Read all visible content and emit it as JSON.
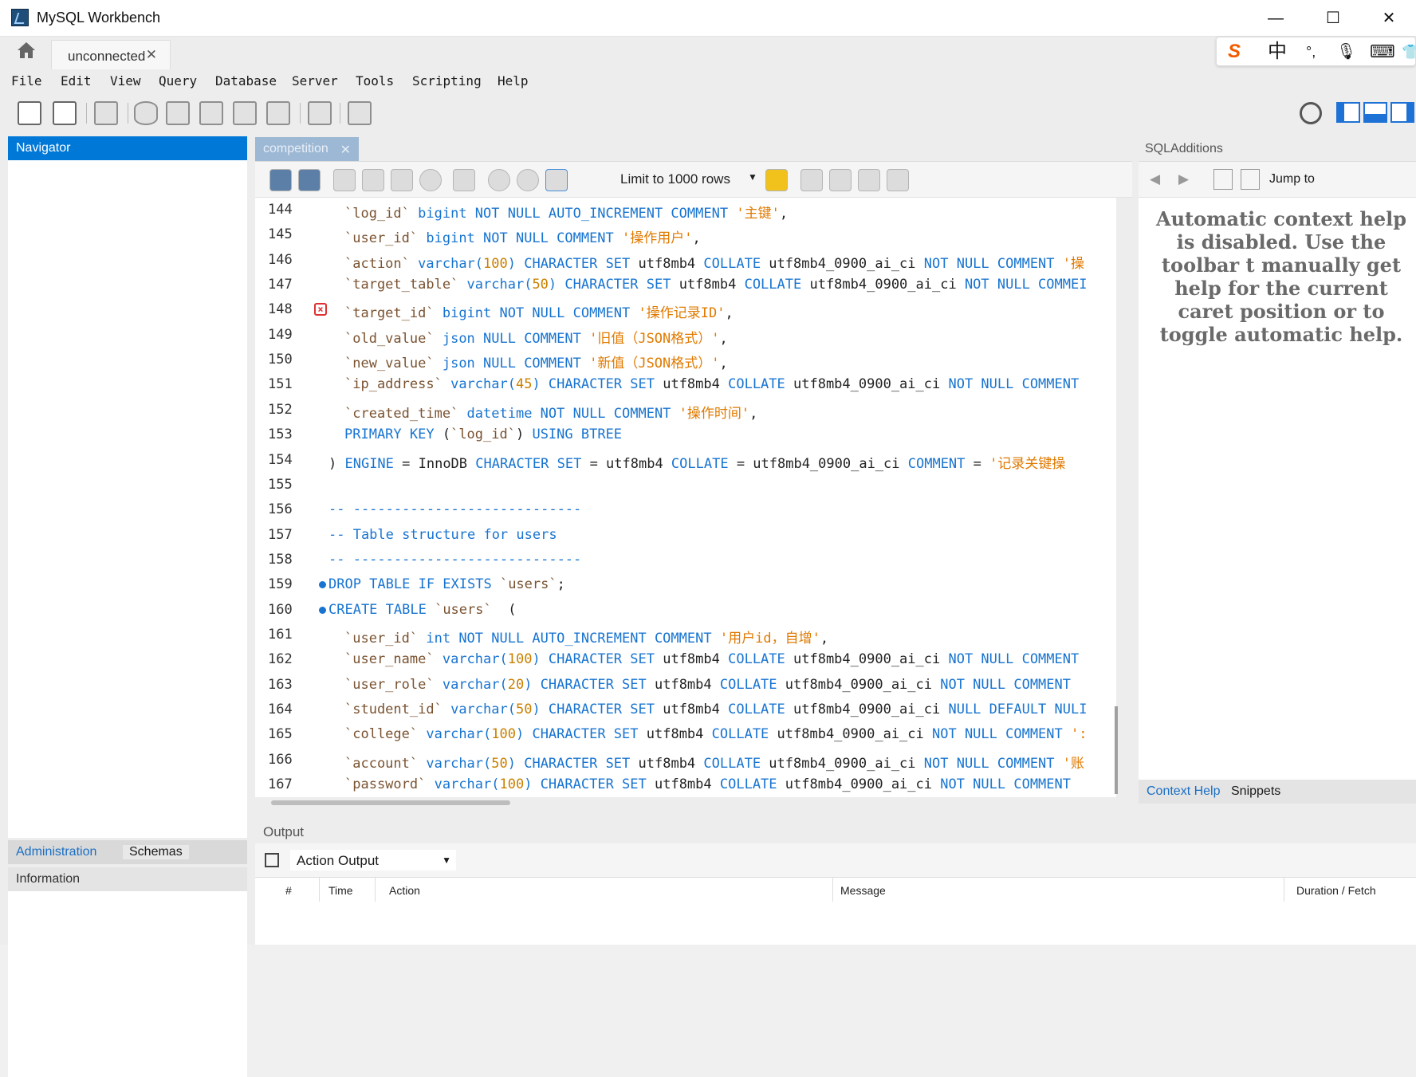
{
  "window": {
    "title": "MySQL Workbench",
    "minimize": "—",
    "maximize": "☐",
    "close": "✕"
  },
  "tabs": {
    "connection_label": "unconnected",
    "close": "✕"
  },
  "ime": {
    "logo": "S",
    "lang": "中",
    "punct": "°,",
    "mic": "🎙",
    "kbd": "⌨",
    "more": "👕"
  },
  "menu": [
    "File",
    "Edit",
    "View",
    "Query",
    "Database",
    "Server",
    "Tools",
    "Scripting",
    "Help"
  ],
  "navigator": {
    "title": "Navigator",
    "tabs": [
      "Administration",
      "Schemas"
    ],
    "info_title": "Information"
  },
  "editor": {
    "tab_label": "competition",
    "limit_label": "Limit to 1000 rows",
    "lines": [
      {
        "n": "144",
        "marker": "",
        "tokens": [
          [
            "id",
            "`log_id`"
          ],
          [
            "plain",
            " "
          ],
          [
            "kw",
            "bigint NOT NULL AUTO_INCREMENT COMMENT"
          ],
          [
            "plain",
            " "
          ],
          [
            "str",
            "'主键'"
          ],
          [
            "plain",
            ","
          ]
        ]
      },
      {
        "n": "145",
        "marker": "",
        "tokens": [
          [
            "id",
            "`user_id`"
          ],
          [
            "plain",
            " "
          ],
          [
            "kw",
            "bigint NOT NULL COMMENT"
          ],
          [
            "plain",
            " "
          ],
          [
            "str",
            "'操作用户'"
          ],
          [
            "plain",
            ","
          ]
        ]
      },
      {
        "n": "146",
        "marker": "",
        "tokens": [
          [
            "id",
            "`action`"
          ],
          [
            "plain",
            " "
          ],
          [
            "kw",
            "varchar("
          ],
          [
            "num",
            "100"
          ],
          [
            "kw",
            ") CHARACTER SET"
          ],
          [
            "plain",
            " utf8mb4 "
          ],
          [
            "kw",
            "COLLATE"
          ],
          [
            "plain",
            " utf8mb4_0900_ai_ci "
          ],
          [
            "kw",
            "NOT NULL COMMENT"
          ],
          [
            "plain",
            " "
          ],
          [
            "str",
            "'操"
          ]
        ]
      },
      {
        "n": "147",
        "marker": "",
        "tokens": [
          [
            "id",
            "`target_table`"
          ],
          [
            "plain",
            " "
          ],
          [
            "kw",
            "varchar("
          ],
          [
            "num",
            "50"
          ],
          [
            "kw",
            ") CHARACTER SET"
          ],
          [
            "plain",
            " utf8mb4 "
          ],
          [
            "kw",
            "COLLATE"
          ],
          [
            "plain",
            " utf8mb4_0900_ai_ci "
          ],
          [
            "kw",
            "NOT NULL COMMEI"
          ]
        ]
      },
      {
        "n": "148",
        "marker": "err",
        "tokens": [
          [
            "id",
            "`target_id`"
          ],
          [
            "plain",
            " "
          ],
          [
            "kw",
            "bigint NOT NULL COMMENT"
          ],
          [
            "plain",
            " "
          ],
          [
            "str",
            "'操作记录ID'"
          ],
          [
            "plain",
            ","
          ]
        ]
      },
      {
        "n": "149",
        "marker": "",
        "tokens": [
          [
            "id",
            "`old_value`"
          ],
          [
            "plain",
            " "
          ],
          [
            "kw",
            "json NULL COMMENT"
          ],
          [
            "plain",
            " "
          ],
          [
            "str",
            "'旧值（JSON格式）'"
          ],
          [
            "plain",
            ","
          ]
        ]
      },
      {
        "n": "150",
        "marker": "",
        "tokens": [
          [
            "id",
            "`new_value`"
          ],
          [
            "plain",
            " "
          ],
          [
            "kw",
            "json NULL COMMENT"
          ],
          [
            "plain",
            " "
          ],
          [
            "str",
            "'新值（JSON格式）'"
          ],
          [
            "plain",
            ","
          ]
        ]
      },
      {
        "n": "151",
        "marker": "",
        "tokens": [
          [
            "id",
            "`ip_address`"
          ],
          [
            "plain",
            " "
          ],
          [
            "kw",
            "varchar("
          ],
          [
            "num",
            "45"
          ],
          [
            "kw",
            ") CHARACTER SET"
          ],
          [
            "plain",
            " utf8mb4 "
          ],
          [
            "kw",
            "COLLATE"
          ],
          [
            "plain",
            " utf8mb4_0900_ai_ci "
          ],
          [
            "kw",
            "NOT NULL COMMENT"
          ]
        ]
      },
      {
        "n": "152",
        "marker": "",
        "tokens": [
          [
            "id",
            "`created_time`"
          ],
          [
            "plain",
            " "
          ],
          [
            "kw",
            "datetime NOT NULL COMMENT"
          ],
          [
            "plain",
            " "
          ],
          [
            "str",
            "'操作时间'"
          ],
          [
            "plain",
            ","
          ]
        ]
      },
      {
        "n": "153",
        "marker": "",
        "tokens": [
          [
            "kw",
            "PRIMARY KEY"
          ],
          [
            "plain",
            " ("
          ],
          [
            "id",
            "`log_id`"
          ],
          [
            "plain",
            ") "
          ],
          [
            "kw",
            "USING BTREE"
          ]
        ]
      },
      {
        "n": "154",
        "marker": "",
        "tokens": [
          [
            "plain",
            ") "
          ],
          [
            "kw",
            "ENGINE"
          ],
          [
            "plain",
            " = InnoDB "
          ],
          [
            "kw",
            "CHARACTER SET"
          ],
          [
            "plain",
            " = utf8mb4 "
          ],
          [
            "kw",
            "COLLATE"
          ],
          [
            "plain",
            " = utf8mb4_0900_ai_ci "
          ],
          [
            "kw",
            "COMMENT"
          ],
          [
            "plain",
            " = "
          ],
          [
            "str",
            "'记录关键操"
          ]
        ]
      },
      {
        "n": "155",
        "marker": "",
        "tokens": []
      },
      {
        "n": "156",
        "marker": "",
        "tokens": [
          [
            "cm",
            "-- ----------------------------"
          ]
        ]
      },
      {
        "n": "157",
        "marker": "",
        "tokens": [
          [
            "cm",
            "-- Table structure for users"
          ]
        ]
      },
      {
        "n": "158",
        "marker": "",
        "tokens": [
          [
            "cm",
            "-- ----------------------------"
          ]
        ]
      },
      {
        "n": "159",
        "marker": "dot",
        "tokens": [
          [
            "kw",
            "DROP TABLE IF EXISTS"
          ],
          [
            "plain",
            " "
          ],
          [
            "id",
            "`users`"
          ],
          [
            "plain",
            ";"
          ]
        ]
      },
      {
        "n": "160",
        "marker": "dot",
        "tokens": [
          [
            "kw",
            "CREATE TABLE"
          ],
          [
            "plain",
            " "
          ],
          [
            "id",
            "`users`"
          ],
          [
            "plain",
            "  ("
          ]
        ]
      },
      {
        "n": "161",
        "marker": "",
        "tokens": [
          [
            "id",
            "`user_id`"
          ],
          [
            "plain",
            " "
          ],
          [
            "kw",
            "int NOT NULL AUTO_INCREMENT COMMENT"
          ],
          [
            "plain",
            " "
          ],
          [
            "str",
            "'用户id，自增'"
          ],
          [
            "plain",
            ","
          ]
        ]
      },
      {
        "n": "162",
        "marker": "",
        "tokens": [
          [
            "id",
            "`user_name`"
          ],
          [
            "plain",
            " "
          ],
          [
            "kw",
            "varchar("
          ],
          [
            "num",
            "100"
          ],
          [
            "kw",
            ") CHARACTER SET"
          ],
          [
            "plain",
            " utf8mb4 "
          ],
          [
            "kw",
            "COLLATE"
          ],
          [
            "plain",
            " utf8mb4_0900_ai_ci "
          ],
          [
            "kw",
            "NOT NULL COMMENT"
          ]
        ]
      },
      {
        "n": "163",
        "marker": "",
        "tokens": [
          [
            "id",
            "`user_role`"
          ],
          [
            "plain",
            " "
          ],
          [
            "kw",
            "varchar("
          ],
          [
            "num",
            "20"
          ],
          [
            "kw",
            ") CHARACTER SET"
          ],
          [
            "plain",
            " utf8mb4 "
          ],
          [
            "kw",
            "COLLATE"
          ],
          [
            "plain",
            " utf8mb4_0900_ai_ci "
          ],
          [
            "kw",
            "NOT NULL COMMENT"
          ]
        ]
      },
      {
        "n": "164",
        "marker": "",
        "tokens": [
          [
            "id",
            "`student_id`"
          ],
          [
            "plain",
            " "
          ],
          [
            "kw",
            "varchar("
          ],
          [
            "num",
            "50"
          ],
          [
            "kw",
            ") CHARACTER SET"
          ],
          [
            "plain",
            " utf8mb4 "
          ],
          [
            "kw",
            "COLLATE"
          ],
          [
            "plain",
            " utf8mb4_0900_ai_ci "
          ],
          [
            "kw",
            "NULL DEFAULT NULI"
          ]
        ]
      },
      {
        "n": "165",
        "marker": "",
        "tokens": [
          [
            "id",
            "`college`"
          ],
          [
            "plain",
            " "
          ],
          [
            "kw",
            "varchar("
          ],
          [
            "num",
            "100"
          ],
          [
            "kw",
            ") CHARACTER SET"
          ],
          [
            "plain",
            " utf8mb4 "
          ],
          [
            "kw",
            "COLLATE"
          ],
          [
            "plain",
            " utf8mb4_0900_ai_ci "
          ],
          [
            "kw",
            "NOT NULL COMMENT"
          ],
          [
            "plain",
            " "
          ],
          [
            "str",
            "':"
          ]
        ]
      },
      {
        "n": "166",
        "marker": "",
        "tokens": [
          [
            "id",
            "`account`"
          ],
          [
            "plain",
            " "
          ],
          [
            "kw",
            "varchar("
          ],
          [
            "num",
            "50"
          ],
          [
            "kw",
            ") CHARACTER SET"
          ],
          [
            "plain",
            " utf8mb4 "
          ],
          [
            "kw",
            "COLLATE"
          ],
          [
            "plain",
            " utf8mb4_0900_ai_ci "
          ],
          [
            "kw",
            "NOT NULL COMMENT"
          ],
          [
            "plain",
            " "
          ],
          [
            "str",
            "'账"
          ]
        ]
      },
      {
        "n": "167",
        "marker": "",
        "tokens": [
          [
            "id",
            "`password`"
          ],
          [
            "plain",
            " "
          ],
          [
            "kw",
            "varchar("
          ],
          [
            "num",
            "100"
          ],
          [
            "kw",
            ") CHARACTER SET"
          ],
          [
            "plain",
            " utf8mb4 "
          ],
          [
            "kw",
            "COLLATE"
          ],
          [
            "plain",
            " utf8mb4_0900_ai_ci "
          ],
          [
            "kw",
            "NOT NULL COMMENT"
          ]
        ]
      }
    ]
  },
  "sql_additions": {
    "title": "SQLAdditions",
    "jump_to": "Jump to",
    "context_help": "Automatic context help is disabled. Use the toolbar t manually get help for the current caret position or to toggle automatic help.",
    "tabs": [
      "Context Help",
      "Snippets"
    ]
  },
  "output": {
    "title": "Output",
    "selector": "Action Output",
    "columns": [
      "#",
      "Time",
      "Action",
      "Message",
      "Duration / Fetch"
    ]
  }
}
